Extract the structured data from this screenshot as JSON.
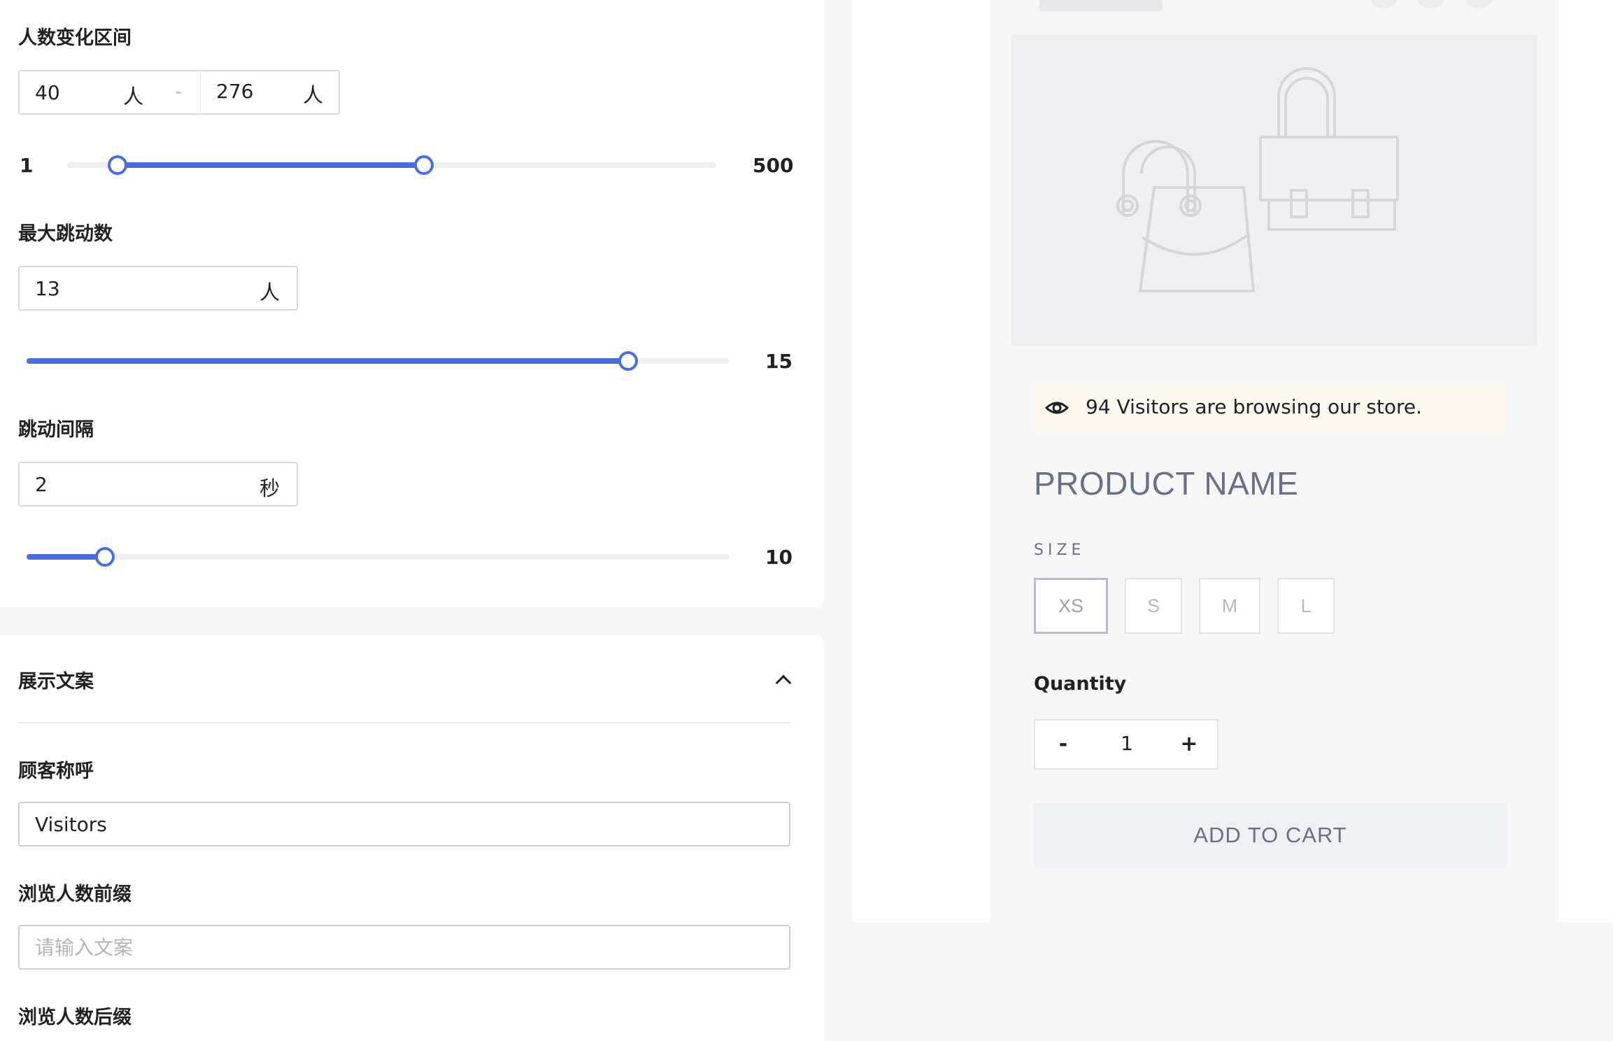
{
  "settings": {
    "range": {
      "label": "人数变化区间",
      "min_value": "40",
      "max_value": "276",
      "unit": "人",
      "dash": "-",
      "slider_min": "1",
      "slider_max": "500"
    },
    "max_jump": {
      "label": "最大跳动数",
      "value": "13",
      "unit": "人",
      "slider_max": "15"
    },
    "interval": {
      "label": "跳动间隔",
      "value": "2",
      "unit": "秒",
      "slider_max": "10"
    },
    "copy_section": {
      "title": "展示文案",
      "customer_label": "顾客称呼",
      "customer_value": "Visitors",
      "prefix_label": "浏览人数前缀",
      "prefix_placeholder": "请输入文案",
      "suffix_label": "浏览人数后缀"
    }
  },
  "preview": {
    "visitors_text": "94 Visitors are browsing our store.",
    "product_name": "PRODUCT NAME",
    "size_label": "SIZE",
    "sizes": [
      "XS",
      "S",
      "M",
      "L"
    ],
    "selected_size": "XS",
    "quantity_label": "Quantity",
    "quantity_minus": "-",
    "quantity_value": "1",
    "quantity_plus": "+",
    "add_to_cart": "ADD TO CART"
  },
  "colors": {
    "accent": "#4a6ee0",
    "banner_bg": "#fdf8ef"
  }
}
